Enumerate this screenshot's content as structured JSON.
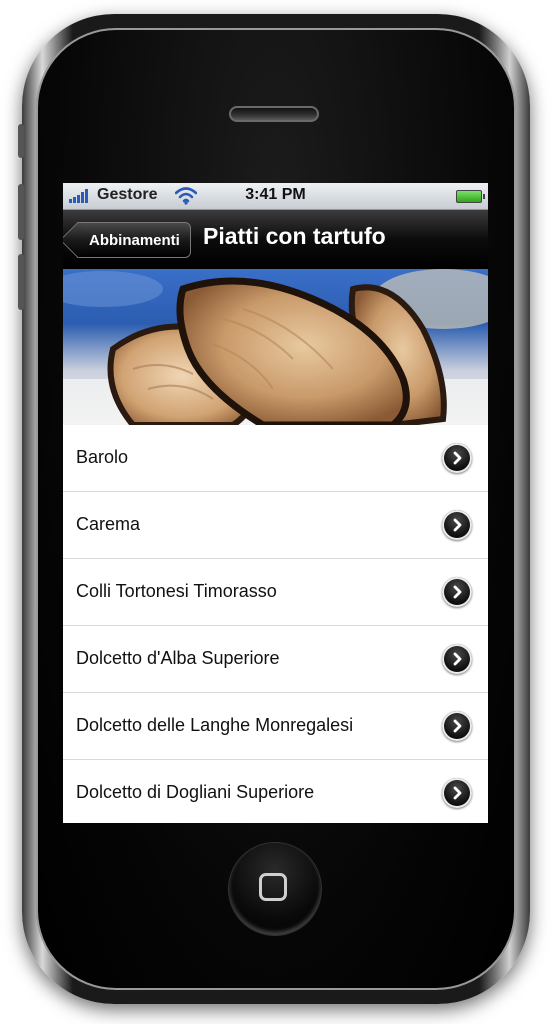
{
  "status_bar": {
    "carrier": "Gestore",
    "time": "3:41 PM",
    "signal_bars": 5,
    "battery_level": 1.0
  },
  "nav_bar": {
    "back_label": "Abbinamenti",
    "title": "Piatti con tartufo"
  },
  "hero": {
    "icon": "truffle-photo"
  },
  "list": {
    "items": [
      {
        "label": "Barolo"
      },
      {
        "label": "Carema"
      },
      {
        "label": "Colli Tortonesi Timorasso"
      },
      {
        "label": "Dolcetto d'Alba Superiore"
      },
      {
        "label": "Dolcetto delle Langhe Monregalesi"
      },
      {
        "label": "Dolcetto di Dogliani Superiore"
      }
    ],
    "accessory_icon": "chevron-right-circle-icon"
  },
  "colors": {
    "nav_bar": "#0c0c0c",
    "signal": "#2a5bb8",
    "battery": "#2ea51a",
    "list_background": "#ffffff",
    "separator": "#d9d9d9"
  }
}
